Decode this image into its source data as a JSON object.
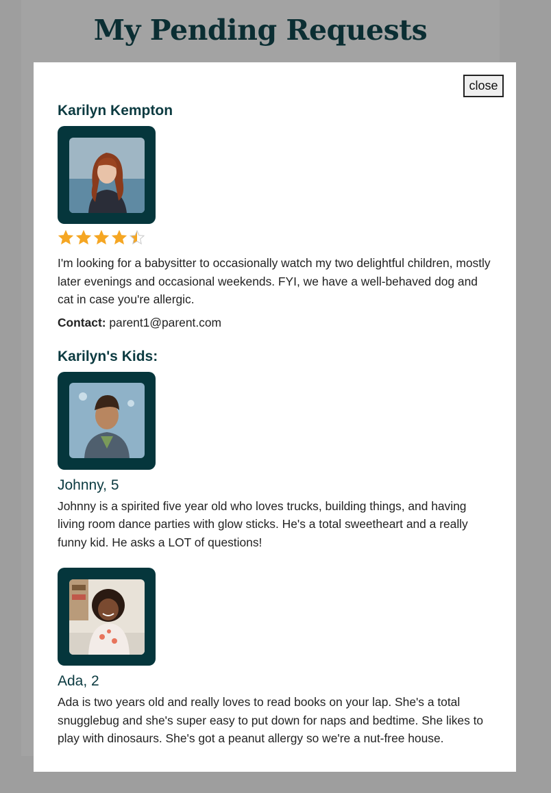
{
  "page": {
    "title": "My Pending Requests"
  },
  "modal": {
    "close_label": "close",
    "parent": {
      "name": "Karilyn Kempton",
      "photo_icon": "parent-photo",
      "rating": 4.5,
      "rating_max": 5,
      "description": "I'm looking for a babysitter to occasionally watch my two delightful children, mostly later evenings and occasional weekends. FYI, we have a well-behaved dog and cat in case you're allergic.",
      "contact_label": "Contact:",
      "contact_value": "parent1@parent.com"
    },
    "kids_heading": "Karilyn's Kids:",
    "kids": [
      {
        "name": "Johnny, 5",
        "description": "Johnny is a spirited five year old who loves trucks, building things, and having living room dance parties with glow sticks. He's a total sweetheart and a really funny kid. He asks a LOT of questions!"
      },
      {
        "name": "Ada, 2",
        "description": "Ada is two years old and really loves to read books on your lap. She's a total snugglebug and she's super easy to put down for naps and bedtime. She likes to play with dinosaurs. She's got a peanut allergy so we're a nut-free house."
      }
    ]
  },
  "colors": {
    "accent": "#05363c",
    "heading": "#0b3a40",
    "star": "#f5a623",
    "overlay": "#9e9e9e"
  }
}
